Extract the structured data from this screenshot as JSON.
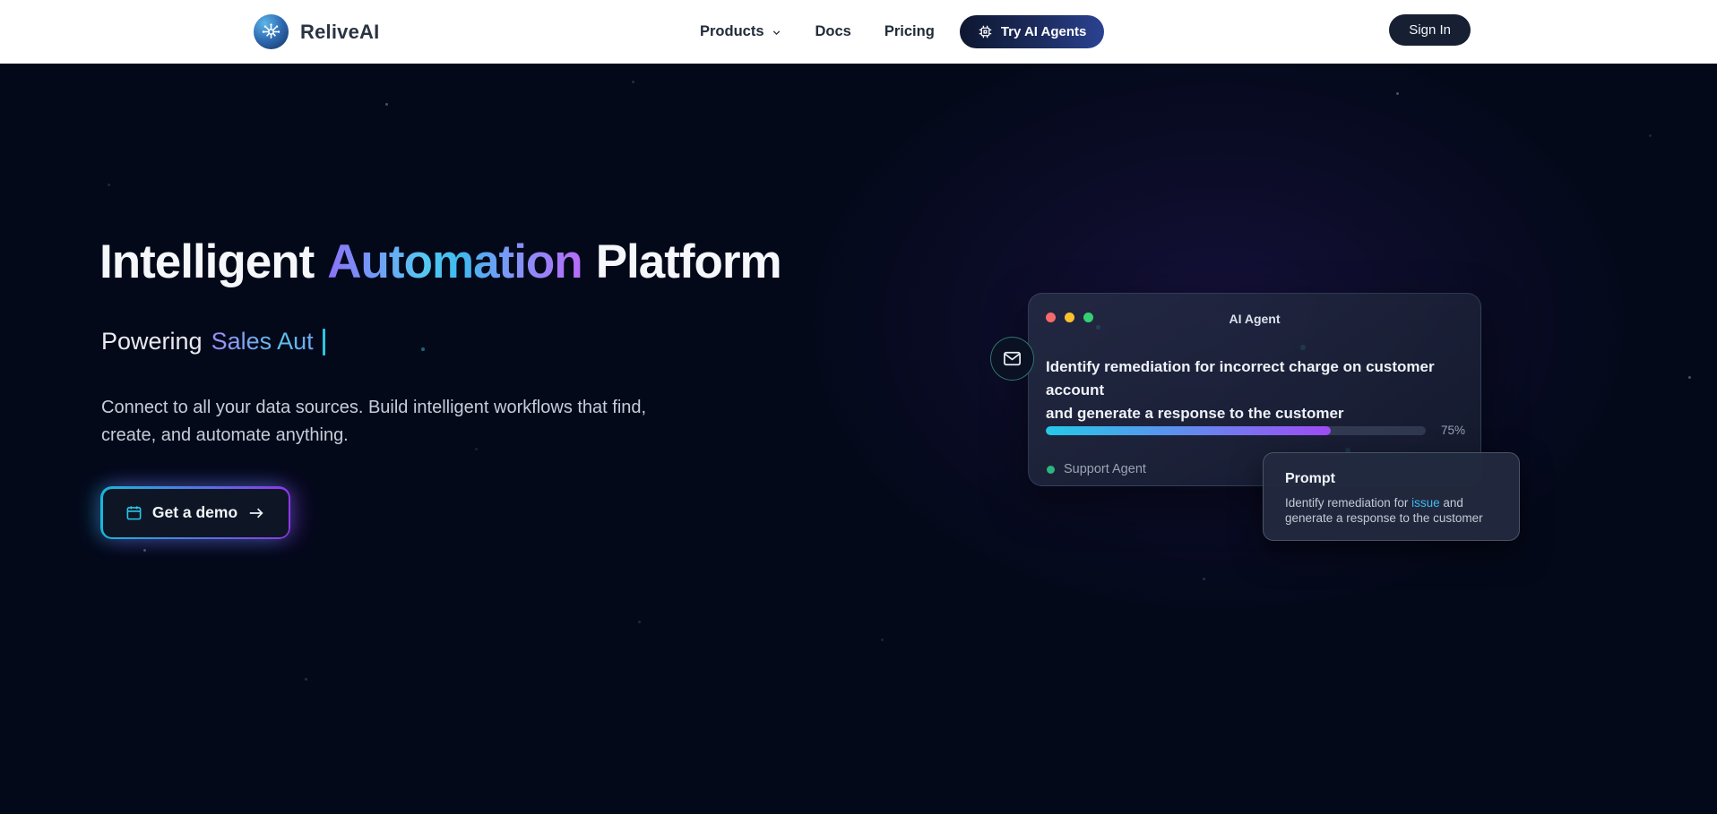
{
  "brand": {
    "name": "ReliveAI"
  },
  "nav": {
    "products_label": "Products",
    "docs_label": "Docs",
    "pricing_label": "Pricing",
    "try_agents_label": "Try AI Agents",
    "sign_in_label": "Sign In"
  },
  "hero": {
    "title_part1": "Intelligent",
    "title_gradient": "Automation",
    "title_part2": "Platform",
    "subtitle_prefix": "Powering",
    "subtitle_typed": "Sales Aut",
    "description_line1": "Connect to all your data sources. Build intelligent workflows that find,",
    "description_line2": "create, and automate anything.",
    "cta_label": "Get a demo"
  },
  "agent_card": {
    "window_title": "AI Agent",
    "task_line1": "Identify remediation for incorrect charge on customer account",
    "task_line2": "and generate a response to the customer",
    "progress_percent": 75,
    "progress_label": "75%",
    "status_label": "Support Agent"
  },
  "prompt_card": {
    "title": "Prompt",
    "body_before_link": "Identify remediation for ",
    "body_link": "issue",
    "body_after_link": " and",
    "body_line2": "generate a response to the customer"
  },
  "icons": {
    "logo": "ai-network",
    "products_chevron": "⌄",
    "try_agents": "chip",
    "cta_calendar": "calendar",
    "cta_arrow": "→",
    "agent_avatar": "envelope",
    "traffic_lights": [
      "red",
      "yellow",
      "green"
    ]
  },
  "colors": {
    "accent_cyan": "#22d3ee",
    "accent_purple": "#a855f7",
    "dark_navy_bg": "#04091a",
    "status_green": "#2cb67d",
    "traffic_red": "#f56b6b",
    "traffic_yellow": "#fcc22d",
    "traffic_green": "#35d073",
    "prompt_link_blue": "#3fb9f0"
  }
}
